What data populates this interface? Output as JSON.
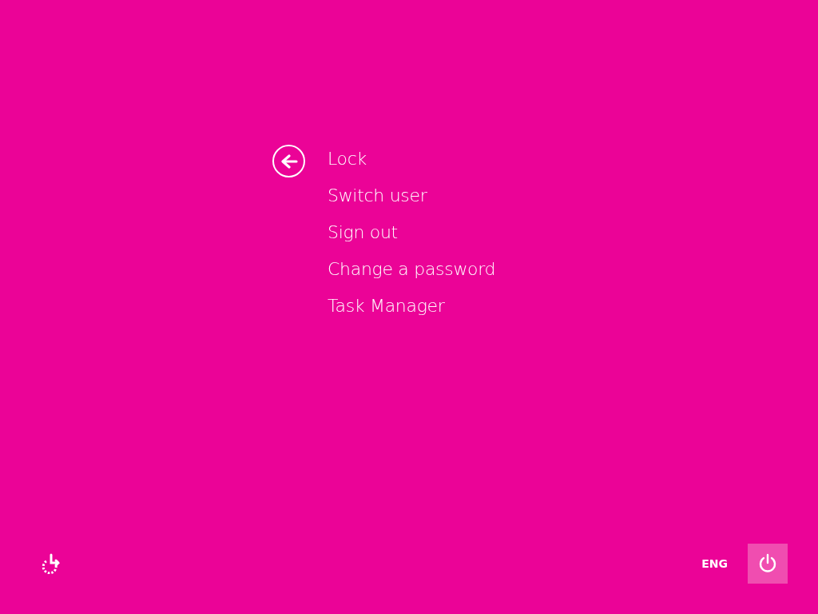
{
  "menu": {
    "items": [
      {
        "label": "Lock"
      },
      {
        "label": "Switch user"
      },
      {
        "label": "Sign out"
      },
      {
        "label": "Change a password"
      },
      {
        "label": "Task Manager"
      }
    ]
  },
  "bottom_bar": {
    "language": "ENG",
    "power_button": {
      "highlighted": true
    }
  }
}
